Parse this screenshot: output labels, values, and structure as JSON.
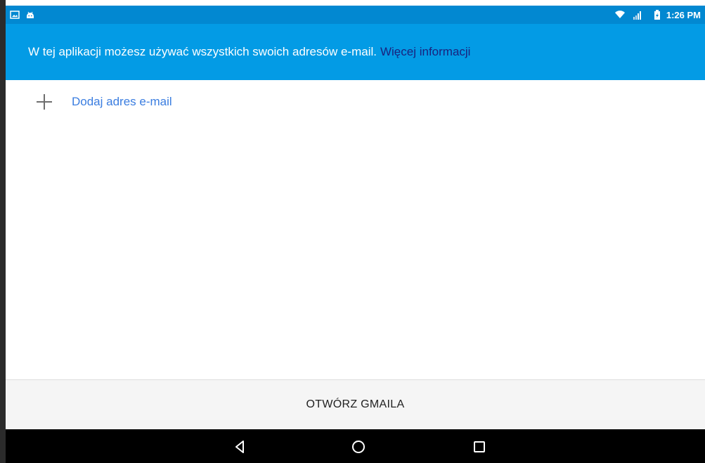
{
  "status_bar": {
    "time": "1:26 PM",
    "left_icons": [
      "image-icon",
      "android-icon"
    ],
    "right_icons": [
      "wifi-icon",
      "signal-icon",
      "battery-icon"
    ],
    "background": "#0288d1"
  },
  "banner": {
    "text": "W tej aplikacji możesz używać wszystkich swoich adresów e-mail.",
    "link": "Więcej informacji",
    "background": "#039be5",
    "link_color": "#1a237e"
  },
  "main": {
    "add_email_label": "Dodaj adres e-mail",
    "accent_color": "#3a7de0"
  },
  "bottom": {
    "open_gmail_label": "OTWÓRZ GMAILA"
  },
  "nav_bar": {
    "buttons": [
      "back-icon",
      "home-icon",
      "recents-icon"
    ]
  }
}
